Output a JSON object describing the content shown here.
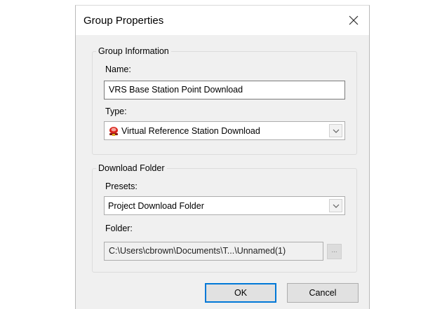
{
  "dialog": {
    "title": "Group Properties",
    "close_glyph": "✕"
  },
  "group_information": {
    "legend": "Group Information",
    "name_label": "Name:",
    "name_value": "VRS Base Station Point Download",
    "type_label": "Type:",
    "type_value": "Virtual Reference Station Download",
    "type_icon": "vrs-station-icon"
  },
  "download_folder": {
    "legend": "Download Folder",
    "presets_label": "Presets:",
    "presets_value": "Project Download Folder",
    "folder_label": "Folder:",
    "folder_value": "C:\\Users\\cbrown\\Documents\\T...\\Unnamed(1)",
    "browse_label": "..."
  },
  "buttons": {
    "ok": "OK",
    "cancel": "Cancel"
  },
  "colors": {
    "dialog_bg": "#f0f0f0",
    "default_button_border": "#0078d7",
    "icon_red": "#d9261c"
  }
}
